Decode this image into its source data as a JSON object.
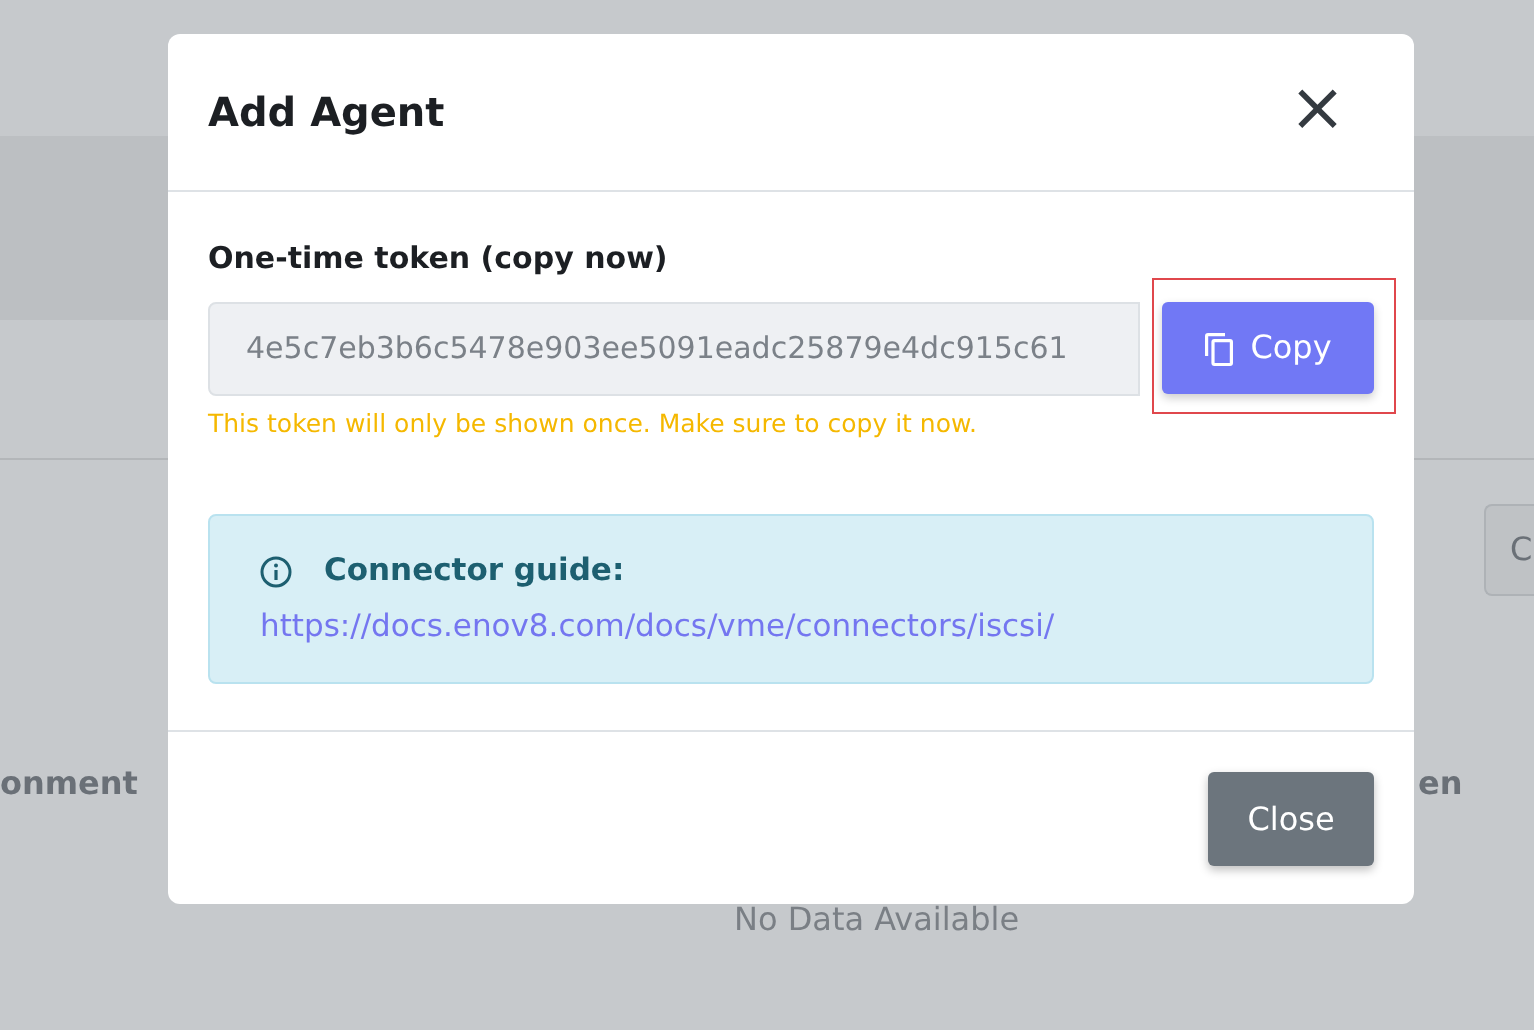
{
  "background": {
    "column_1": "onment",
    "column_2": "en",
    "empty_text": "No Data Available",
    "button_text": "C"
  },
  "dialog": {
    "title": "Add Agent",
    "close_symbol": "×",
    "token_label": "One-time token (copy now)",
    "token_value": "4e5c7eb3b6c5478e903ee5091eadc25879e4dc915c61",
    "copy_button": "Copy",
    "copy_highlighted": true,
    "warning": "This token will only be shown once. Make sure to copy it now.",
    "guide": {
      "title": "Connector guide:",
      "link": "https://docs.enov8.com/docs/vme/connectors/iscsi/"
    },
    "footer_buttons": [
      "Close"
    ]
  }
}
